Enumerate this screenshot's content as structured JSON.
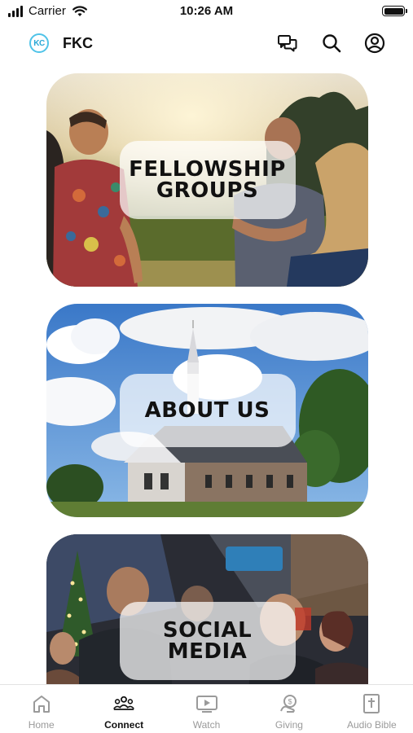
{
  "status_bar": {
    "carrier": "Carrier",
    "time": "10:26 AM"
  },
  "header": {
    "logo_text": "KC",
    "title": "FKC",
    "icons": [
      "chat-bubbles-icon",
      "search-icon",
      "account-icon"
    ]
  },
  "cards": [
    {
      "label_line1": "FELLOWSHIP",
      "label_line2": "GROUPS",
      "image": "people talking outdoors at sunset"
    },
    {
      "label_line1": "ABOUT US",
      "image": "church with steeple under blue sky"
    },
    {
      "label_line1": "SOCIAL",
      "label_line2": "MEDIA",
      "image": "people gathering indoors by a christmas tree"
    }
  ],
  "tabs": [
    {
      "label": "Home",
      "icon": "home-icon",
      "active": false
    },
    {
      "label": "Connect",
      "icon": "group-icon",
      "active": true
    },
    {
      "label": "Watch",
      "icon": "video-icon",
      "active": false
    },
    {
      "label": "Giving",
      "icon": "giving-icon",
      "active": false
    },
    {
      "label": "Audio Bible",
      "icon": "bible-icon",
      "active": false
    }
  ],
  "colors": {
    "accent": "#2aa8d6",
    "tab_inactive": "#9a9a9a",
    "tab_active": "#111111"
  }
}
